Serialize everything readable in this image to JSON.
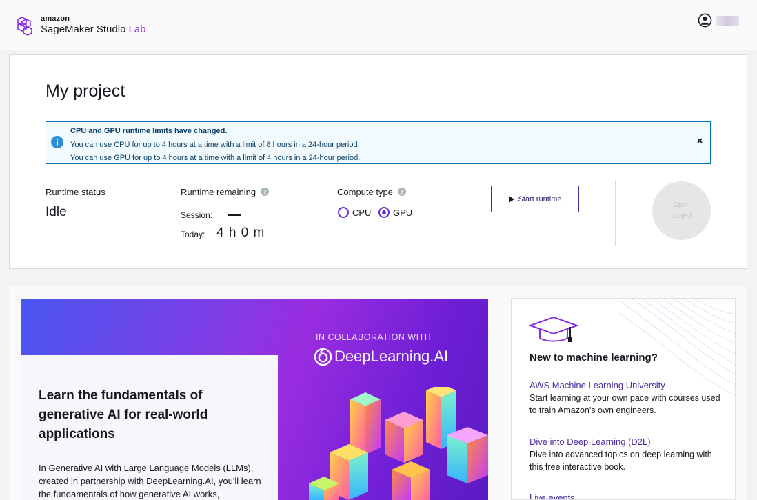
{
  "header": {
    "brand_small": "amazon",
    "brand_main": "SageMaker Studio",
    "brand_accent": "Lab",
    "accent_color": "#8a2be2"
  },
  "project": {
    "title": "My project",
    "alert": {
      "title": "CPU and GPU runtime limits have changed.",
      "line1": "You can use CPU for up to 4 hours at a time with a limit of 8 hours in a 24-hour period.",
      "line2": "You can use GPU for up to 4 hours at a time with a limit of 4 hours in a 24-hour period."
    },
    "runtime_status_label": "Runtime status",
    "runtime_status_value": "Idle",
    "runtime_remaining_label": "Runtime remaining",
    "session_label": "Session:",
    "today_label": "Today:",
    "today_value": "4 h 0 m",
    "compute_type_label": "Compute type",
    "compute_options": [
      "CPU",
      "GPU"
    ],
    "compute_selected": "GPU",
    "start_button": "Start runtime",
    "open_button_line1": "Open",
    "open_button_line2": "project"
  },
  "banner": {
    "heading": "Learn the fundamentals of generative AI for real-world applications",
    "body": "In Generative AI with Large Language Models (LLMs), created in partnership with DeepLearning.AI, you'll learn the fundamentals of how generative AI works,",
    "collab_text": "IN COLLABORATION WITH",
    "partner": "DeepLearning.AI"
  },
  "ml_card": {
    "title": "New to machine learning?",
    "links": [
      {
        "label": "AWS Machine Learning University",
        "desc": "Start learning at your own pace with courses used to train Amazon's own engineers."
      },
      {
        "label": "Dive into Deep Learning (D2L)",
        "desc": "Dive into advanced topics on deep learning with this free interactive book."
      },
      {
        "label": "Live events",
        "desc": ""
      }
    ]
  }
}
